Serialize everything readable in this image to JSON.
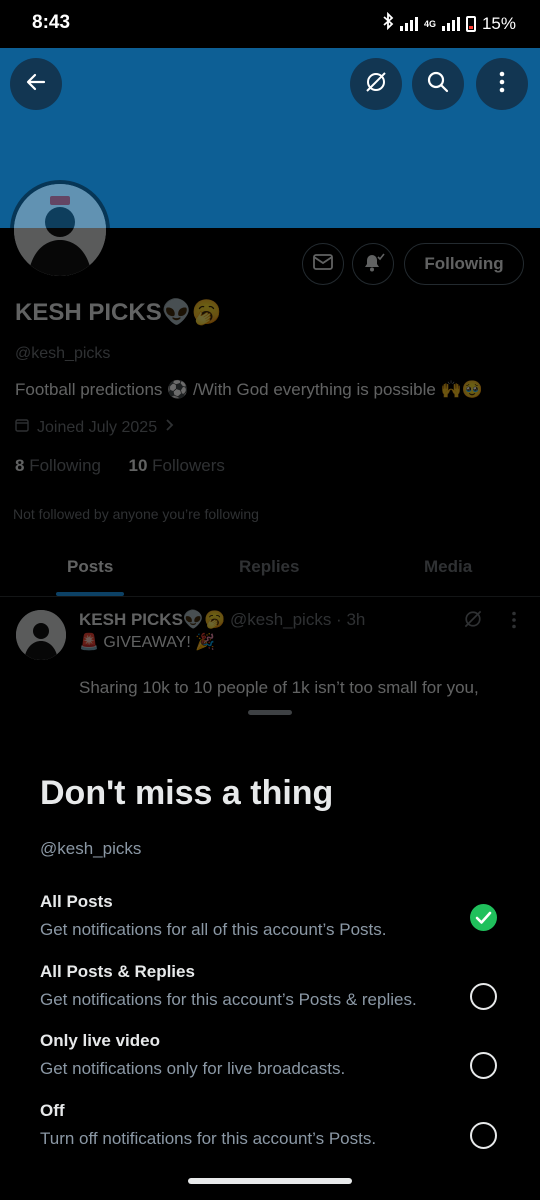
{
  "status_bar": {
    "time": "8:43",
    "network": "4G",
    "battery": "15%"
  },
  "profile": {
    "name": "KESH PICKS",
    "name_emojis": "👽🥱",
    "handle": "@kesh_picks",
    "bio": "Football predictions ⚽ /With God everything is possible 🙌🥹",
    "joined": "Joined July 2025",
    "following_count": "8",
    "following_label": "Following",
    "followers_count": "10",
    "followers_label": "Followers",
    "not_followed": "Not followed by anyone you’re following",
    "follow_button": "Following"
  },
  "tabs": [
    "Posts",
    "Replies",
    "Media"
  ],
  "post": {
    "author": "KESH PICKS👽🥱",
    "meta": "@kesh_picks · 3h",
    "line1": "🚨 GIVEAWAY! 🎉",
    "line2": "Sharing 10k to 10 people of 1k isn’t too small for you,"
  },
  "sheet": {
    "title": "Don't miss a thing",
    "subtitle": "@kesh_picks",
    "options": [
      {
        "title": "All Posts",
        "desc": "Get notifications for all of this account’s Posts.",
        "selected": true
      },
      {
        "title": "All Posts & Replies",
        "desc": "Get notifications for this account’s Posts & replies.",
        "selected": false
      },
      {
        "title": "Only live video",
        "desc": "Get notifications only for live broadcasts.",
        "selected": false
      },
      {
        "title": "Off",
        "desc": "Turn off notifications for this account’s Posts.",
        "selected": false
      }
    ]
  },
  "colors": {
    "banner": "#0d5f95",
    "accent": "#1d9bf0",
    "check": "#20c05c"
  },
  "icons": [
    "back-arrow-icon",
    "grok-icon",
    "search-icon",
    "more-vert-icon",
    "mail-icon",
    "bell-icon",
    "calendar-icon",
    "chevron-right-icon",
    "check-icon"
  ]
}
